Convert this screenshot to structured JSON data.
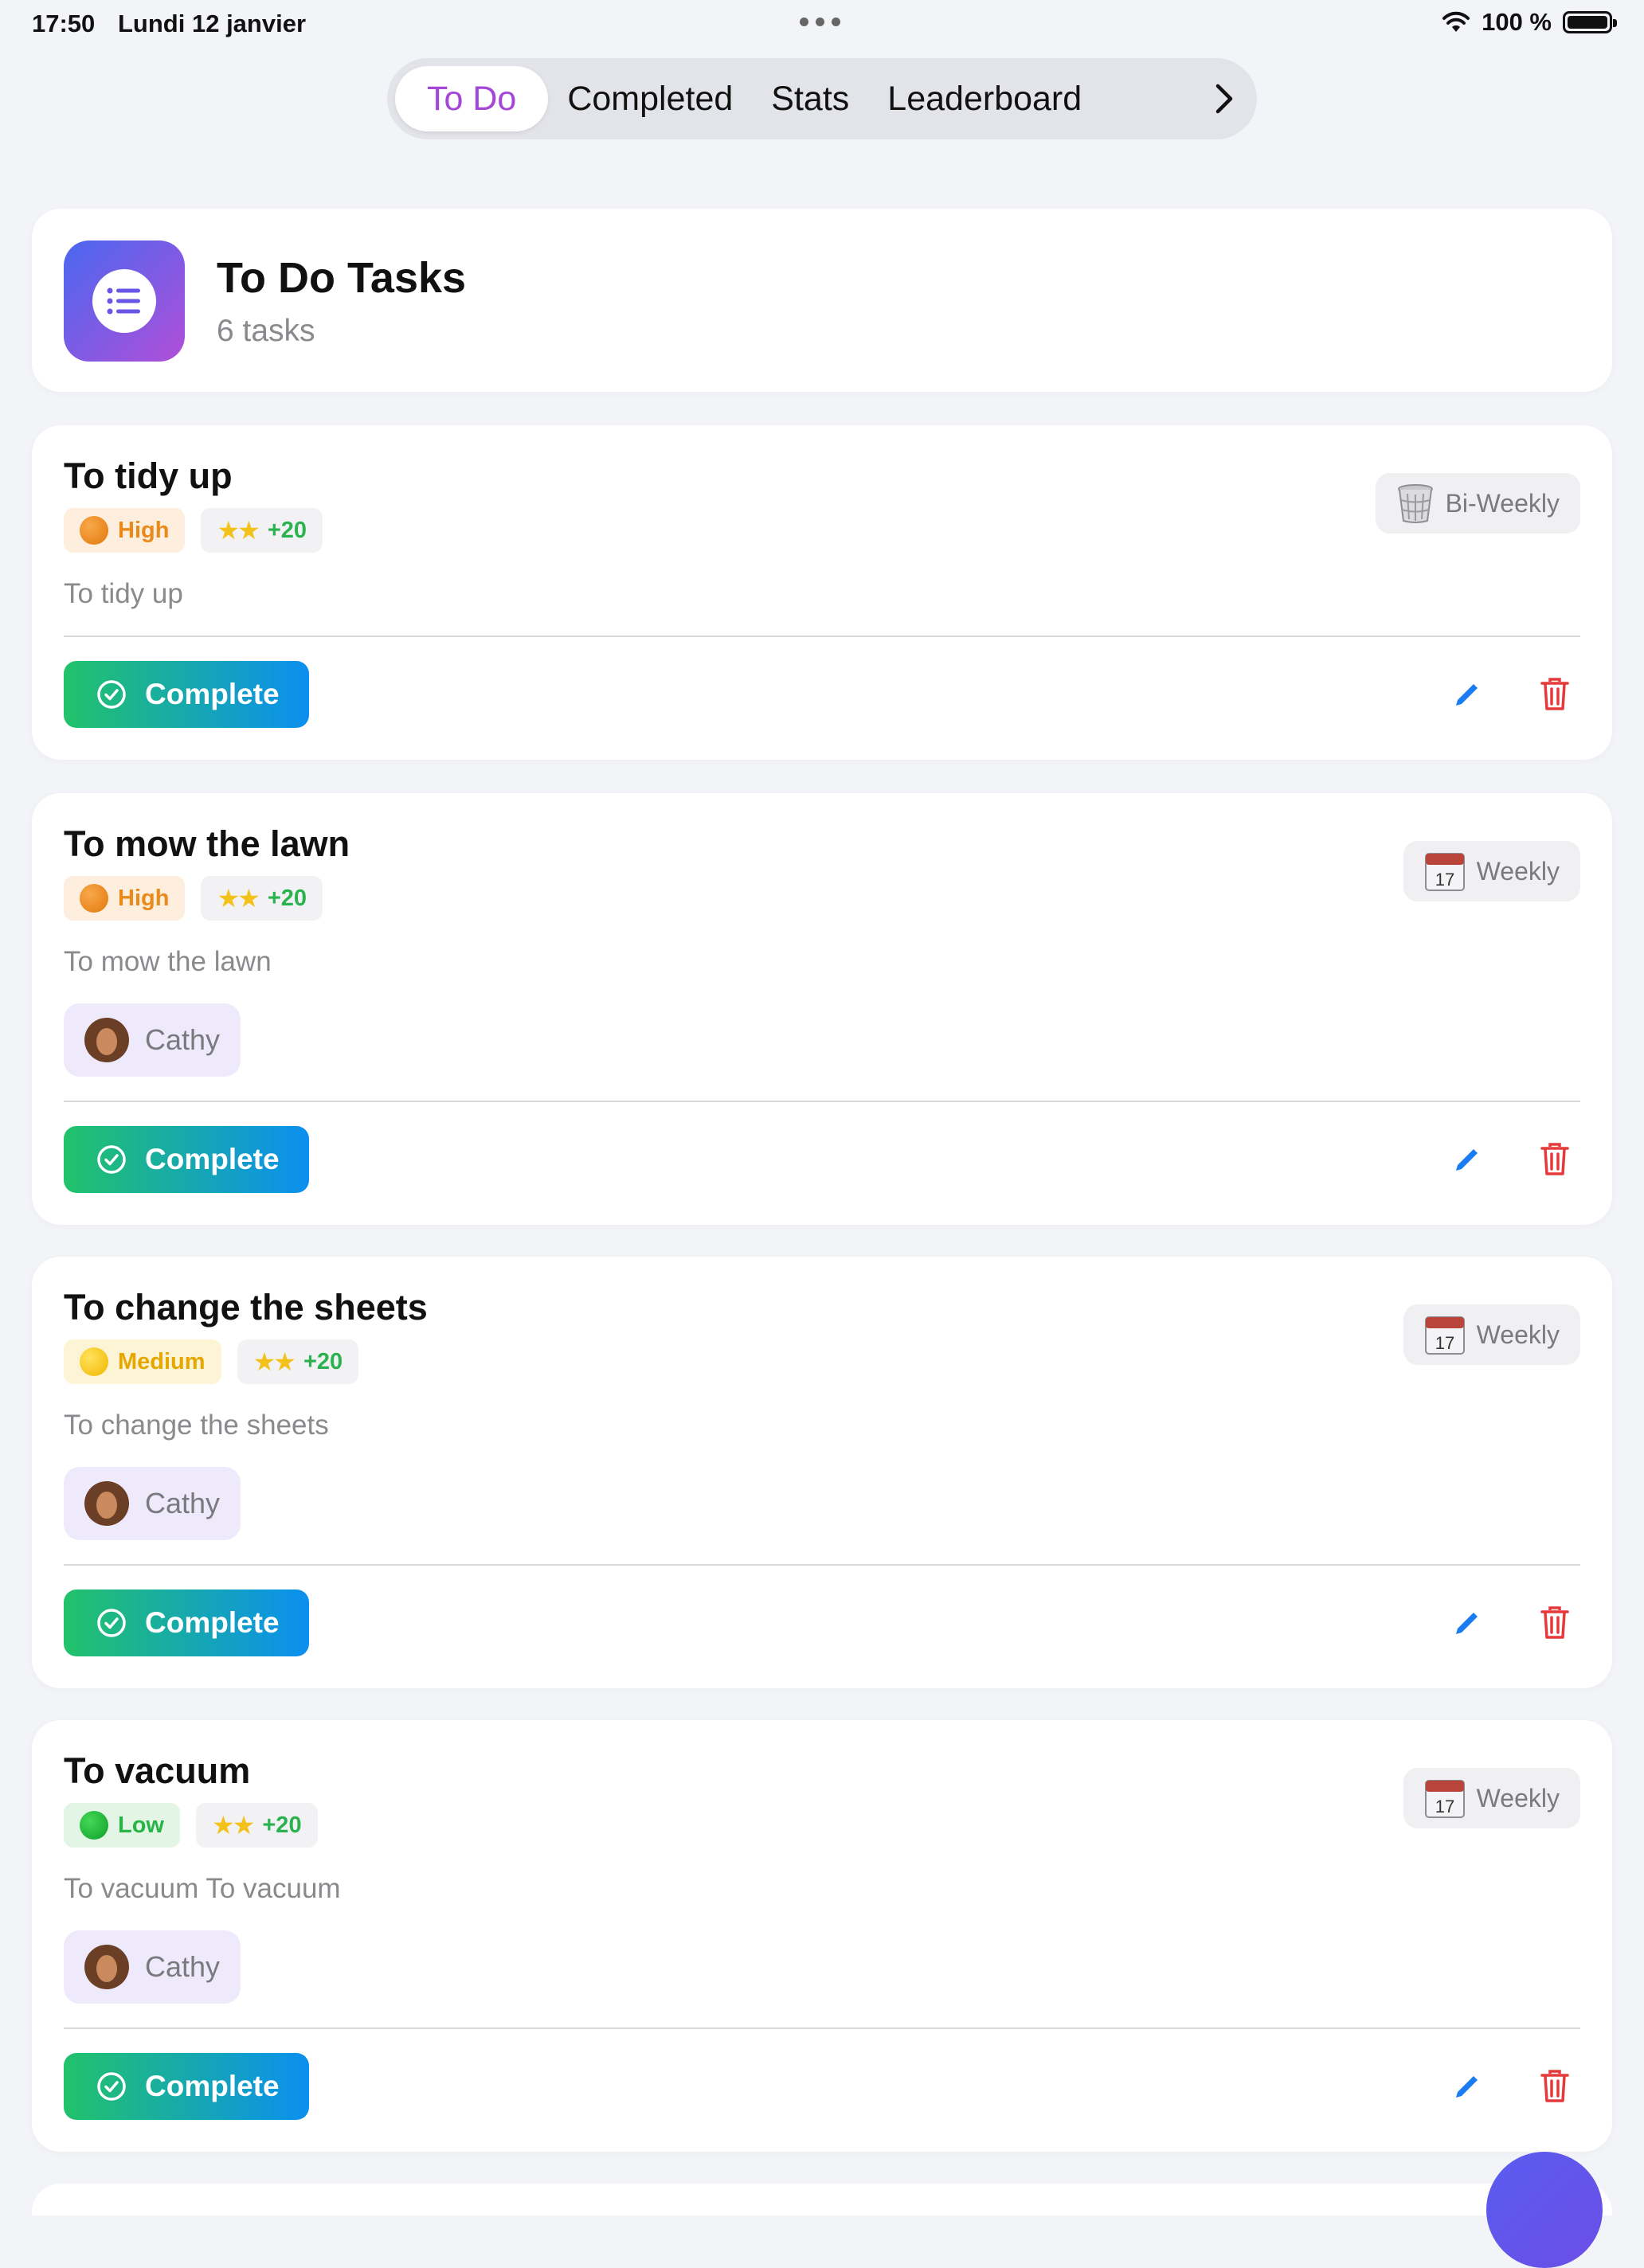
{
  "status": {
    "time": "17:50",
    "date": "Lundi 12 janvier",
    "battery": "100 %"
  },
  "tabs": [
    {
      "label": "To Do",
      "active": true
    },
    {
      "label": "Completed",
      "active": false
    },
    {
      "label": "Stats",
      "active": false
    },
    {
      "label": "Leaderboard",
      "active": false
    }
  ],
  "header": {
    "title": "To Do Tasks",
    "subtitle": "6 tasks",
    "icon": "list-icon"
  },
  "complete_label": "Complete",
  "tasks": [
    {
      "title": "To tidy up",
      "priority": "High",
      "points": "+20",
      "frequency": "Bi-Weekly",
      "frequency_icon": "wastebasket-icon",
      "description": "To tidy up",
      "assignee": null
    },
    {
      "title": "To mow the lawn",
      "priority": "High",
      "points": "+20",
      "frequency": "Weekly",
      "frequency_icon": "calendar-icon",
      "description": "To mow the lawn",
      "assignee": "Cathy"
    },
    {
      "title": "To change the sheets",
      "priority": "Medium",
      "points": "+20",
      "frequency": "Weekly",
      "frequency_icon": "calendar-icon",
      "description": "To change the sheets",
      "assignee": "Cathy"
    },
    {
      "title": "To vacuum",
      "priority": "Low",
      "points": "+20",
      "frequency": "Weekly",
      "frequency_icon": "calendar-icon",
      "description": "To vacuum To vacuum",
      "assignee": "Cathy"
    }
  ],
  "calendar_day": "17",
  "colors": {
    "accent": "#a447d6",
    "complete_start": "#22c26a",
    "complete_end": "#0b8ff0",
    "edit": "#1b7cf2",
    "delete": "#e5393b"
  }
}
